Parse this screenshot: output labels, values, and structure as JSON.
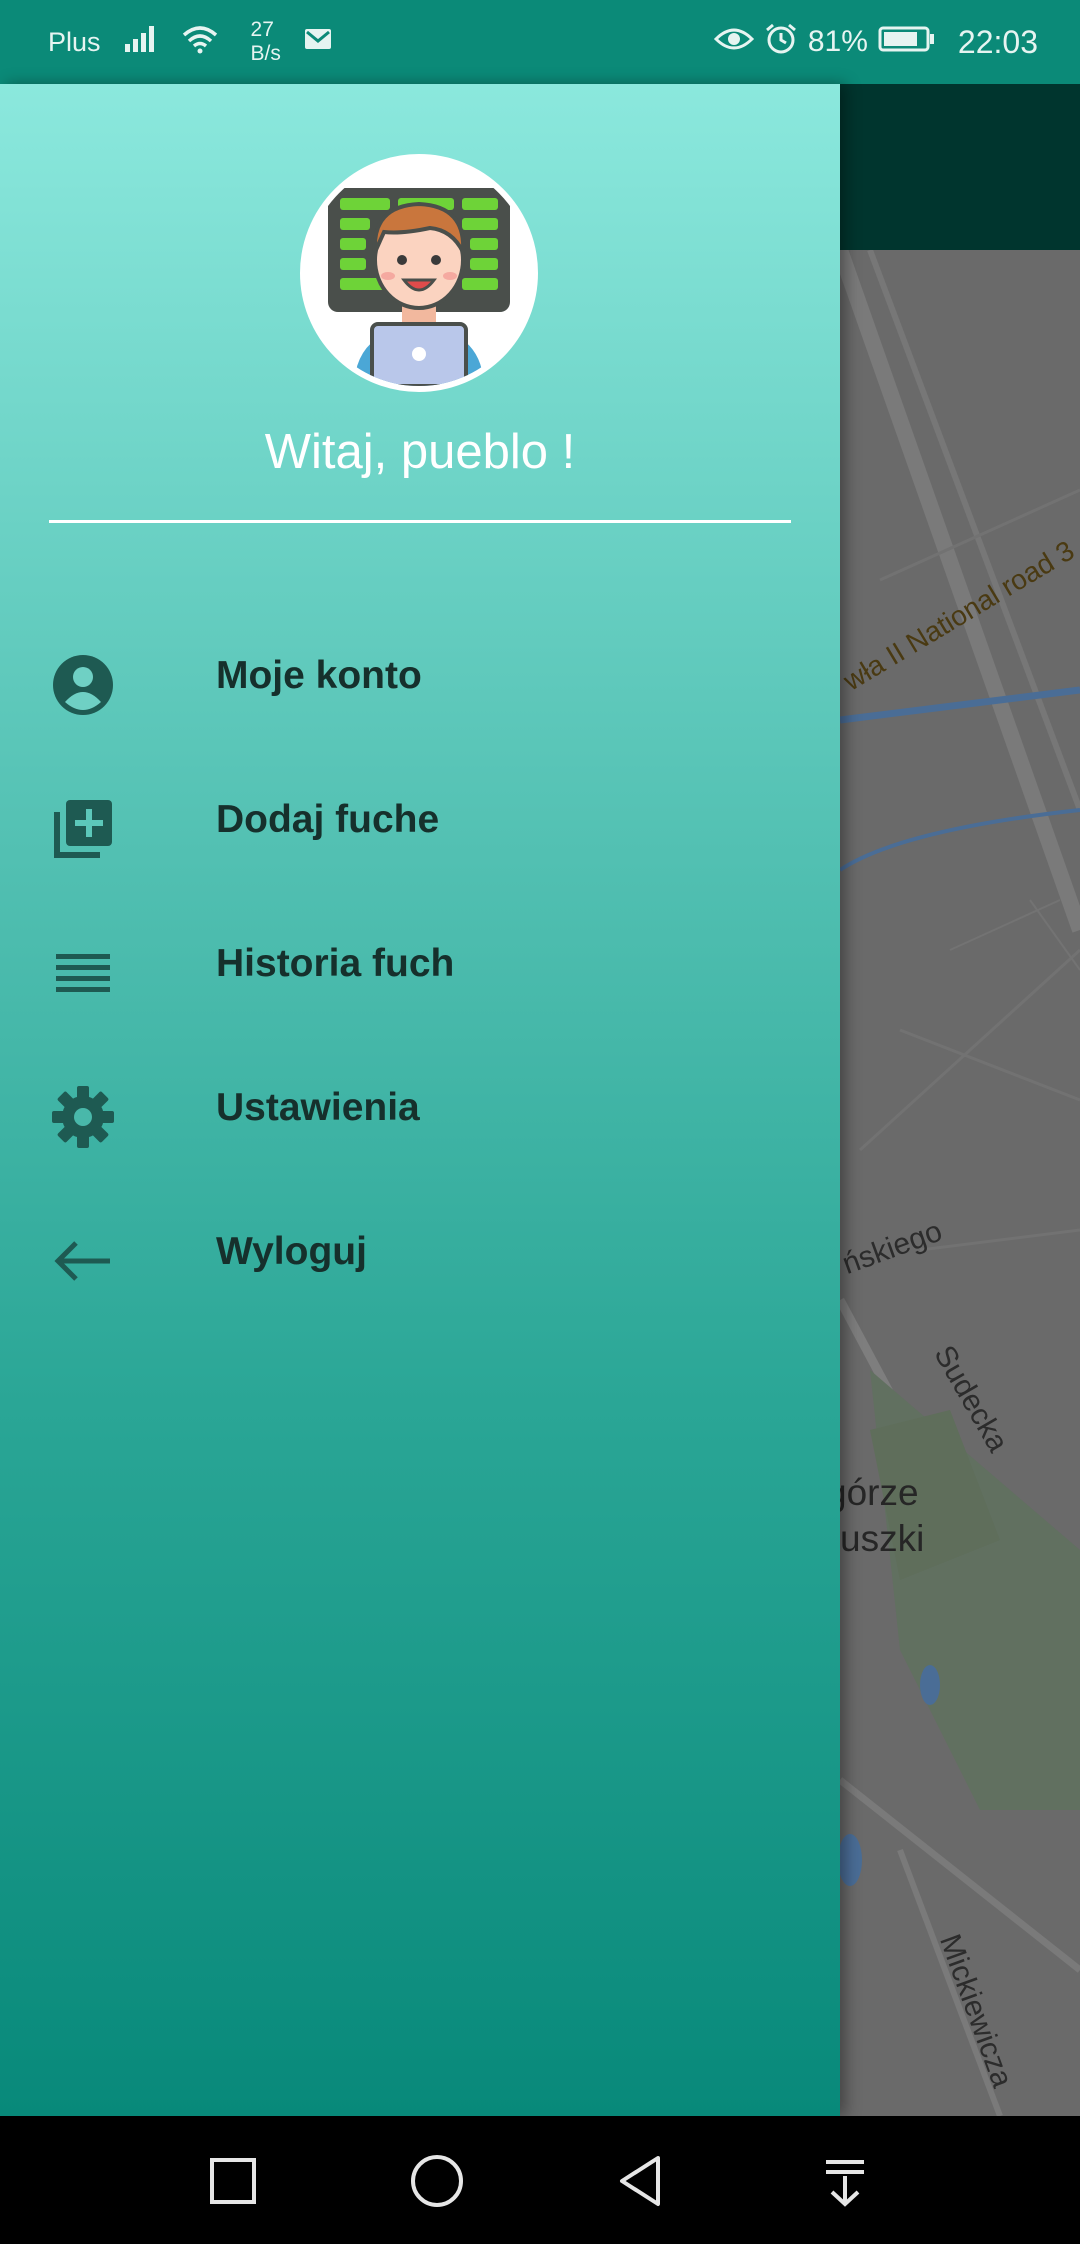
{
  "status_bar": {
    "carrier": "Plus",
    "net_speed_value": "27",
    "net_speed_unit": "B/s",
    "battery_percent": "81%",
    "time": "22:03",
    "icons": [
      "signal-icon",
      "wifi-icon",
      "gmail-icon",
      "eye-icon",
      "alarm-icon",
      "battery-icon"
    ]
  },
  "drawer": {
    "greeting": "Witaj, pueblo !",
    "avatar": "developer-avatar",
    "menu": [
      {
        "label": "Moje konto",
        "icon": "account-circle-icon"
      },
      {
        "label": "Dodaj fuche",
        "icon": "library-add-icon"
      },
      {
        "label": "Historia fuch",
        "icon": "list-icon"
      },
      {
        "label": "Ustawienia",
        "icon": "gear-icon"
      },
      {
        "label": "Wyloguj",
        "icon": "arrow-back-icon"
      }
    ]
  },
  "map": {
    "labels": {
      "highway": "wła II National road 3",
      "street1": "ńskiego",
      "street2": "Sudecka",
      "district_line1": "górze",
      "district_line2": "uszki",
      "street3": "Mickiewicza"
    }
  },
  "nav_bar": {
    "buttons": [
      "recents-button",
      "home-button",
      "back-button",
      "notifications-button"
    ]
  },
  "colors": {
    "status_bar": "#0b8a78",
    "app_bar": "#00352e",
    "drawer_top": "#8be8dd",
    "drawer_bottom": "#08897a",
    "menu_text": "#16302c",
    "icon": "#1e5a52"
  }
}
